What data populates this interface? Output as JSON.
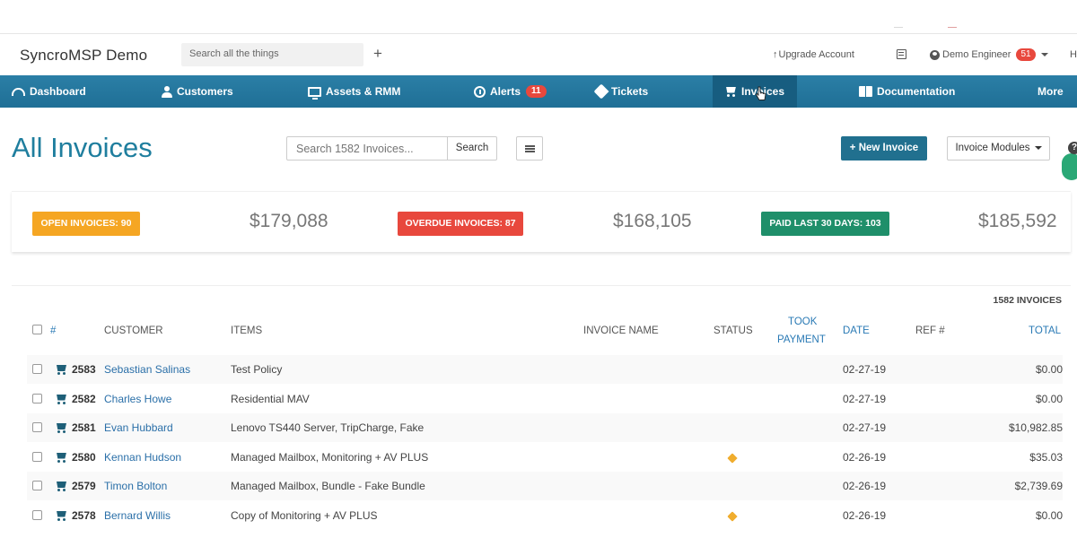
{
  "app": {
    "brand": "SyncroMSP Demo"
  },
  "header": {
    "search_placeholder": "Search all the things",
    "upgrade": "Upgrade Account",
    "user": "Demo Engineer",
    "user_badge": "51",
    "cut_letter": "H"
  },
  "nav": {
    "items": [
      {
        "label": "Dashboard"
      },
      {
        "label": "Customers"
      },
      {
        "label": "Assets & RMM"
      },
      {
        "label": "Alerts",
        "badge": "11"
      },
      {
        "label": "Tickets"
      },
      {
        "label": "Invoices",
        "active": true
      },
      {
        "label": "Documentation"
      },
      {
        "label": "More"
      }
    ]
  },
  "page": {
    "title": "All Invoices",
    "search_placeholder": "Search 1582 Invoices...",
    "search_button": "Search",
    "new_invoice": "+ New Invoice",
    "modules": "Invoice Modules",
    "help": "?"
  },
  "stats": [
    {
      "label": "OPEN INVOICES: 90",
      "amount": "$179,088",
      "color": "#f5a623"
    },
    {
      "label": "OVERDUE INVOICES: 87",
      "amount": "$168,105",
      "color": "#e8483d"
    },
    {
      "label": "PAID LAST 30 DAYS: 103",
      "amount": "$185,592",
      "color": "#1f8f6a"
    }
  ],
  "table": {
    "count": "1582 INVOICES",
    "headers": {
      "number": "#",
      "customer": "CUSTOMER",
      "items": "ITEMS",
      "invoice_name": "INVOICE NAME",
      "status": "STATUS",
      "took_payment_1": "TOOK",
      "took_payment_2": "PAYMENT",
      "date": "DATE",
      "ref": "REF #",
      "total": "TOTAL"
    },
    "rows": [
      {
        "number": "2583",
        "customer": "Sebastian Salinas",
        "items": "Test Policy",
        "status_tag": false,
        "date": "02-27-19",
        "total": "$0.00"
      },
      {
        "number": "2582",
        "customer": "Charles Howe",
        "items": "Residential MAV",
        "status_tag": false,
        "date": "02-27-19",
        "total": "$0.00"
      },
      {
        "number": "2581",
        "customer": "Evan Hubbard",
        "items": "Lenovo TS440 Server, TripCharge, Fake",
        "status_tag": false,
        "date": "02-27-19",
        "total": "$10,982.85"
      },
      {
        "number": "2580",
        "customer": "Kennan Hudson",
        "items": "Managed Mailbox, Monitoring + AV PLUS",
        "status_tag": true,
        "date": "02-26-19",
        "total": "$35.03"
      },
      {
        "number": "2579",
        "customer": "Timon Bolton",
        "items": "Managed Mailbox, Bundle - Fake Bundle",
        "status_tag": false,
        "date": "02-26-19",
        "total": "$2,739.69"
      },
      {
        "number": "2578",
        "customer": "Bernard Willis",
        "items": "Copy of Monitoring + AV PLUS",
        "status_tag": true,
        "date": "02-26-19",
        "total": "$0.00"
      }
    ]
  }
}
